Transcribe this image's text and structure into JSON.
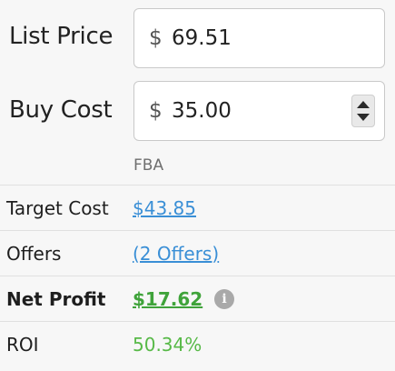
{
  "pricing": {
    "list_price": {
      "label": "List Price",
      "currency": "$",
      "value": "69.51"
    },
    "buy_cost": {
      "label": "Buy Cost",
      "currency": "$",
      "value": "35.00"
    },
    "fulfillment_note": "FBA"
  },
  "details": {
    "target_cost": {
      "label": "Target Cost",
      "value": "$43.85"
    },
    "offers": {
      "label": "Offers",
      "value": "(2 Offers)"
    },
    "net_profit": {
      "label": "Net Profit",
      "value": "$17.62",
      "info_icon_glyph": "i"
    },
    "roi": {
      "label": "ROI",
      "value": "50.34%"
    }
  },
  "colors": {
    "link_blue": "#3a8fd6",
    "profit_green": "#3fa33a",
    "roi_green": "#57b947",
    "background": "#f7f7f7"
  }
}
